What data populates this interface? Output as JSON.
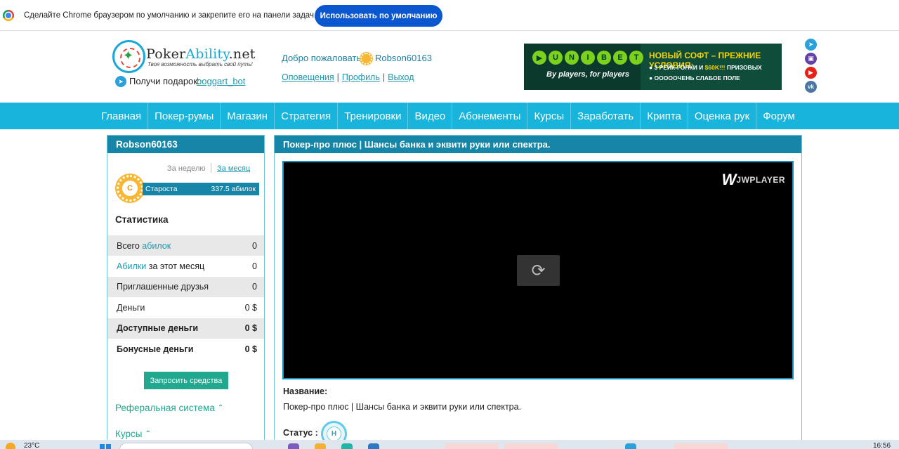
{
  "chrome_infobar": {
    "message": "Сделайте Chrome браузером по умолчанию и закрепите его на панели задач.",
    "button": "Использовать по умолчанию"
  },
  "header": {
    "logo_part1": "Poker",
    "logo_part2": "Ability",
    "logo_part3": ".net",
    "slogan": "Твоя возможность выбрать свой путь!",
    "gift_label": "Получи подарок:",
    "gift_link": "boggart_bot",
    "welcome": "Добро пожаловать,",
    "username": "Robson60163",
    "links": [
      "Оповещения",
      "Профиль",
      "Выход"
    ]
  },
  "banner": {
    "brand_letters": [
      "▶",
      "U",
      "N",
      "I",
      "B",
      "E",
      "T"
    ],
    "tagline": "By players, for players",
    "headline": "НОВЫЙ СОФТ – ПРЕЖНИЕ УСЛОВИЯ:",
    "line1_prefix": "● 3 РЕЙК-ГОНКИ И",
    "line1_amount": "$60K!!!",
    "line1_suffix": "ПРИЗОВЫХ",
    "line2": "● ОООООЧЕНЬ СЛАБОЕ ПОЛЕ"
  },
  "social": [
    {
      "icon": "telegram-icon",
      "glyph": "➤",
      "color": "#2aa1da"
    },
    {
      "icon": "twitch-icon",
      "glyph": "▣",
      "color": "#6441a5"
    },
    {
      "icon": "youtube-icon",
      "glyph": "▶",
      "color": "#e62117"
    },
    {
      "icon": "vk-icon",
      "glyph": "vk",
      "color": "#4c75a3"
    }
  ],
  "nav": [
    "Главная",
    "Покер-румы",
    "Магазин",
    "Стратегия",
    "Тренировки",
    "Видео",
    "Абонементы",
    "Курсы",
    "Заработать",
    "Крипта",
    "Оценка рук",
    "Форум"
  ],
  "sidebar": {
    "title": "Robson60163",
    "period_week": "За неделю",
    "period_month": "За месяц",
    "rank_letter": "С",
    "rank_name": "Староста",
    "rank_points": "337.5 абилок",
    "stats_title": "Статистика",
    "stats": [
      {
        "prefix": "Всего ",
        "highlight": "абилок",
        "suffix": "",
        "value": "0",
        "shaded": true,
        "bold": false
      },
      {
        "prefix": "",
        "highlight": "Абилки",
        "suffix": " за этот месяц",
        "value": "0",
        "shaded": false,
        "bold": false
      },
      {
        "prefix": "Приглашенные друзья",
        "highlight": "",
        "suffix": "",
        "value": "0",
        "shaded": true,
        "bold": false
      },
      {
        "prefix": "Деньги",
        "highlight": "",
        "suffix": "",
        "value": "0 $",
        "shaded": false,
        "bold": false
      },
      {
        "prefix": "Доступные деньги",
        "highlight": "",
        "suffix": "",
        "value": "0 $",
        "shaded": true,
        "bold": true
      },
      {
        "prefix": "Бонусные деньги",
        "highlight": "",
        "suffix": "",
        "value": "0 $",
        "shaded": false,
        "bold": true
      }
    ],
    "request_button": "Запросить средства",
    "referral": "Реферальная система",
    "courses": "Курсы"
  },
  "main": {
    "title": "Покер-про плюс | Шансы банка и эквити руки или спектра.",
    "player_brand": "JWPLAYER",
    "name_label": "Название:",
    "name_value": "Покер-про плюс | Шансы банка и эквити руки или спектра.",
    "status_label": "Статус :",
    "status_letter": "Н"
  },
  "taskbar": {
    "temperature": "23°C",
    "time": "16:56"
  }
}
